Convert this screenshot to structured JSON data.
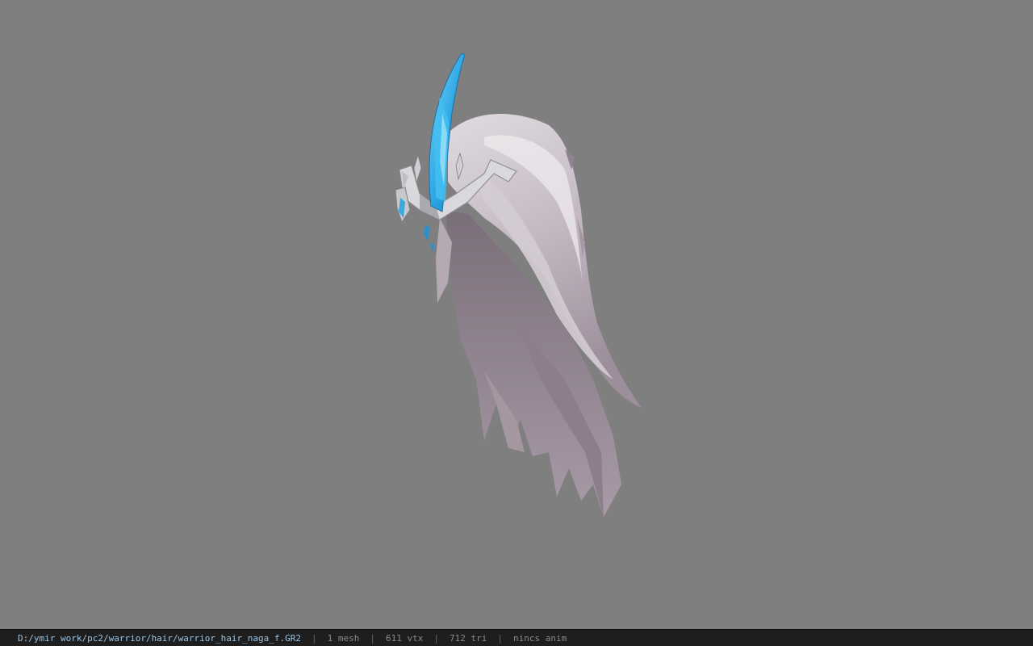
{
  "viewer": {
    "background_color": "#7f7f7f",
    "model_name": "warrior_hair_naga_f",
    "colors": {
      "hair_light": "#dcd7dc",
      "hair_shadow": "#8d7f8c",
      "crystal": "#3fb6ec",
      "crown_metal": "#c8c8cc"
    }
  },
  "status": {
    "file_path": "D:/ymir work/pc2/warrior/hair/warrior_hair_naga_f.GR2",
    "separator": "|",
    "mesh_count": "1 mesh",
    "vertex_count": "611 vtx",
    "triangle_count": "712 tri",
    "anim_status": "nincs anim"
  }
}
